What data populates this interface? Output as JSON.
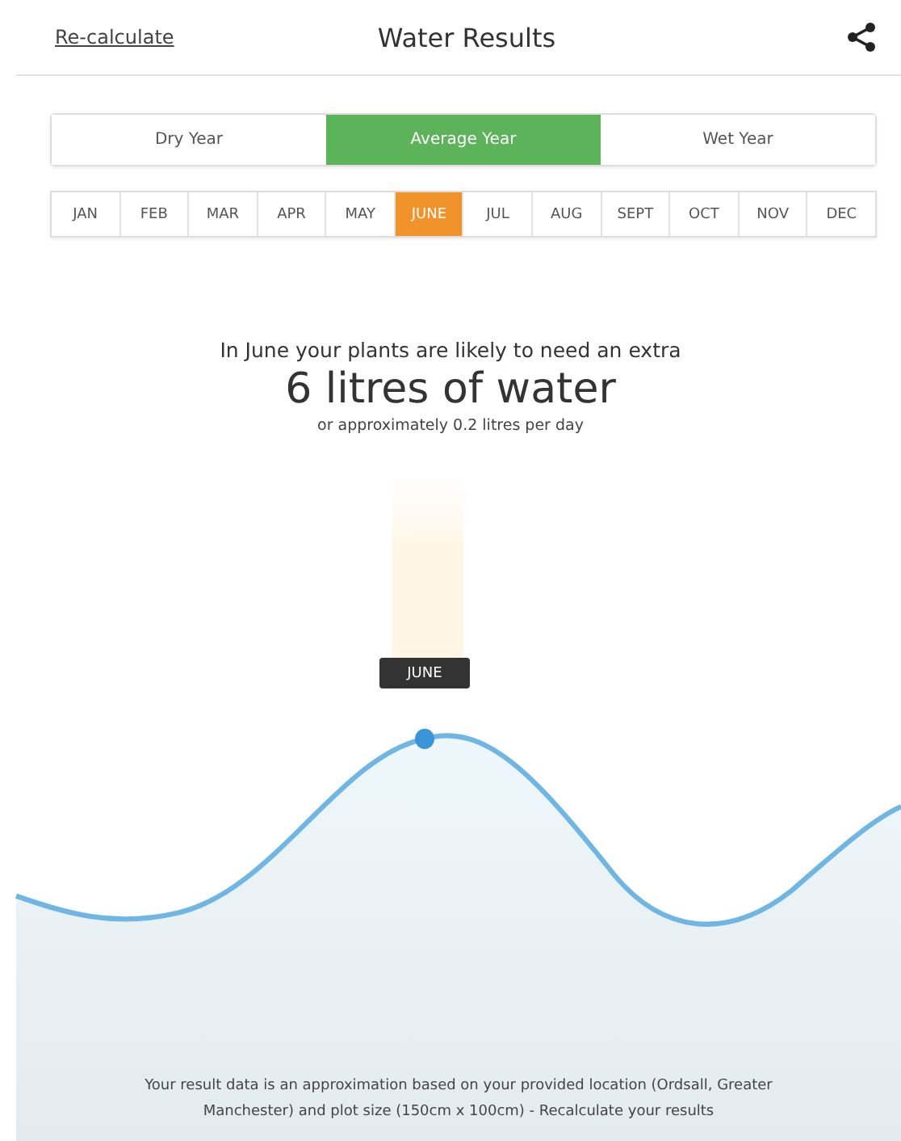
{
  "header": {
    "link": "Re-calculate",
    "title": "Water Results"
  },
  "year_tabs": [
    {
      "label": "Dry Year",
      "selected": false
    },
    {
      "label": "Average Year",
      "selected": true
    },
    {
      "label": "Wet Year",
      "selected": false
    }
  ],
  "months": [
    {
      "label": "JAN",
      "selected": false
    },
    {
      "label": "FEB",
      "selected": false
    },
    {
      "label": "MAR",
      "selected": false
    },
    {
      "label": "APR",
      "selected": false
    },
    {
      "label": "MAY",
      "selected": false
    },
    {
      "label": "JUNE",
      "selected": true
    },
    {
      "label": "JUL",
      "selected": false
    },
    {
      "label": "AUG",
      "selected": false
    },
    {
      "label": "SEPT",
      "selected": false
    },
    {
      "label": "OCT",
      "selected": false
    },
    {
      "label": "NOV",
      "selected": false
    },
    {
      "label": "DEC",
      "selected": false
    }
  ],
  "result": {
    "intro": "In June your plants are likely to need an extra",
    "amount": "6 litres of water",
    "daily": "or approximately 0.2 litres per day"
  },
  "chart": {
    "tooltip": "JUNE"
  },
  "footer": "Your result data is an approximation based on your provided location (Ordsall, Greater Manchester) and plot size (150cm x 100cm) - Recalculate your results"
}
